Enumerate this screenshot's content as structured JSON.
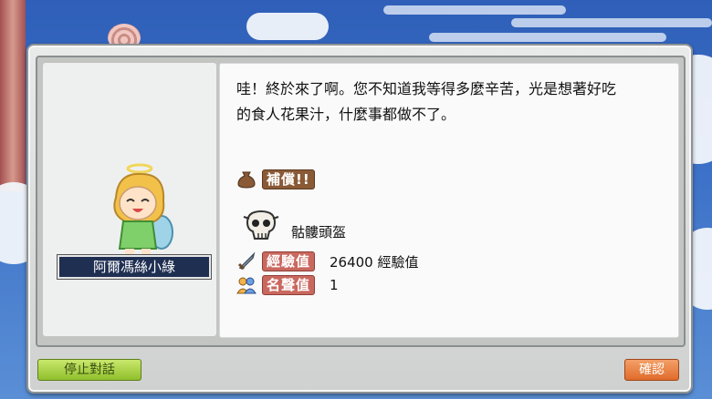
{
  "npc": {
    "name": "阿爾馮絲小綠"
  },
  "dialog": {
    "line1": "哇！終於來了啊。您不知道我等得多麼辛苦，光是想著好吃",
    "line2": "的食人花果汁，什麼事都做不了。"
  },
  "reward": {
    "title": "補償!!",
    "item": {
      "name": "骷髏頭盔",
      "icon": "skull-helmet-icon"
    },
    "exp": {
      "label": "經驗值",
      "value": "26400 經驗值",
      "icon": "sword-icon"
    },
    "fame": {
      "label": "名聲值",
      "value": "1",
      "icon": "people-icon"
    }
  },
  "buttons": {
    "end_chat": "停止對話",
    "confirm": "確認"
  },
  "colors": {
    "name_plate": "#1f2f52",
    "badge_brown": "#8a5a36",
    "badge_red": "#c9685f",
    "end_button": "#8fbf2c",
    "ok_button": "#e06b2b"
  }
}
